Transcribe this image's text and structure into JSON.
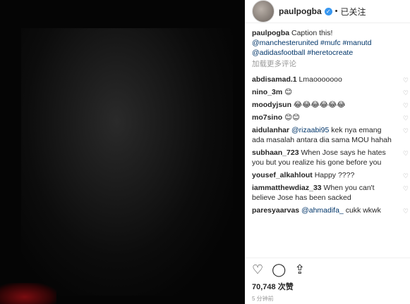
{
  "post": {
    "username": "paulpogba",
    "follow_status": "已关注",
    "caption_user": "paulpogba",
    "caption_text": " Caption this!",
    "caption_tags_1": "@manchesterunited #mufc #manutd",
    "caption_tags_2": "@adidasfootball #heretocreate",
    "load_more": "加载更多评论"
  },
  "comments": [
    {
      "user": "abdisamad.1",
      "text": " Lmaooooooo"
    },
    {
      "user": "nino_3m",
      "text": " 😊"
    },
    {
      "user": "moodyjsun",
      "text": " 😂😂😂😂😂😂"
    },
    {
      "user": "mo7sino",
      "text": " 😊😊"
    },
    {
      "user": "aidulanhar",
      "mention": " @rizaabi95",
      "text": " kek nya emang ada masalah antara dia sama MOU hahah"
    },
    {
      "user": "subhaan_723",
      "text": " When Jose says he hates you but you realize his gone before you"
    },
    {
      "user": "yousef_alkahlout",
      "text": " Happy ????"
    },
    {
      "user": "iammatthewdiaz_33",
      "text": " When you can't believe Jose has been sacked"
    },
    {
      "user": "paresyaarvas",
      "mention": " @ahmadifa_",
      "text": " cukk wkwk"
    }
  ],
  "footer": {
    "likes": "70,748 次赞",
    "time": "5 分钟前"
  },
  "icons": [
    "verified-badge",
    "heart-icon",
    "comment-icon",
    "share-icon"
  ]
}
